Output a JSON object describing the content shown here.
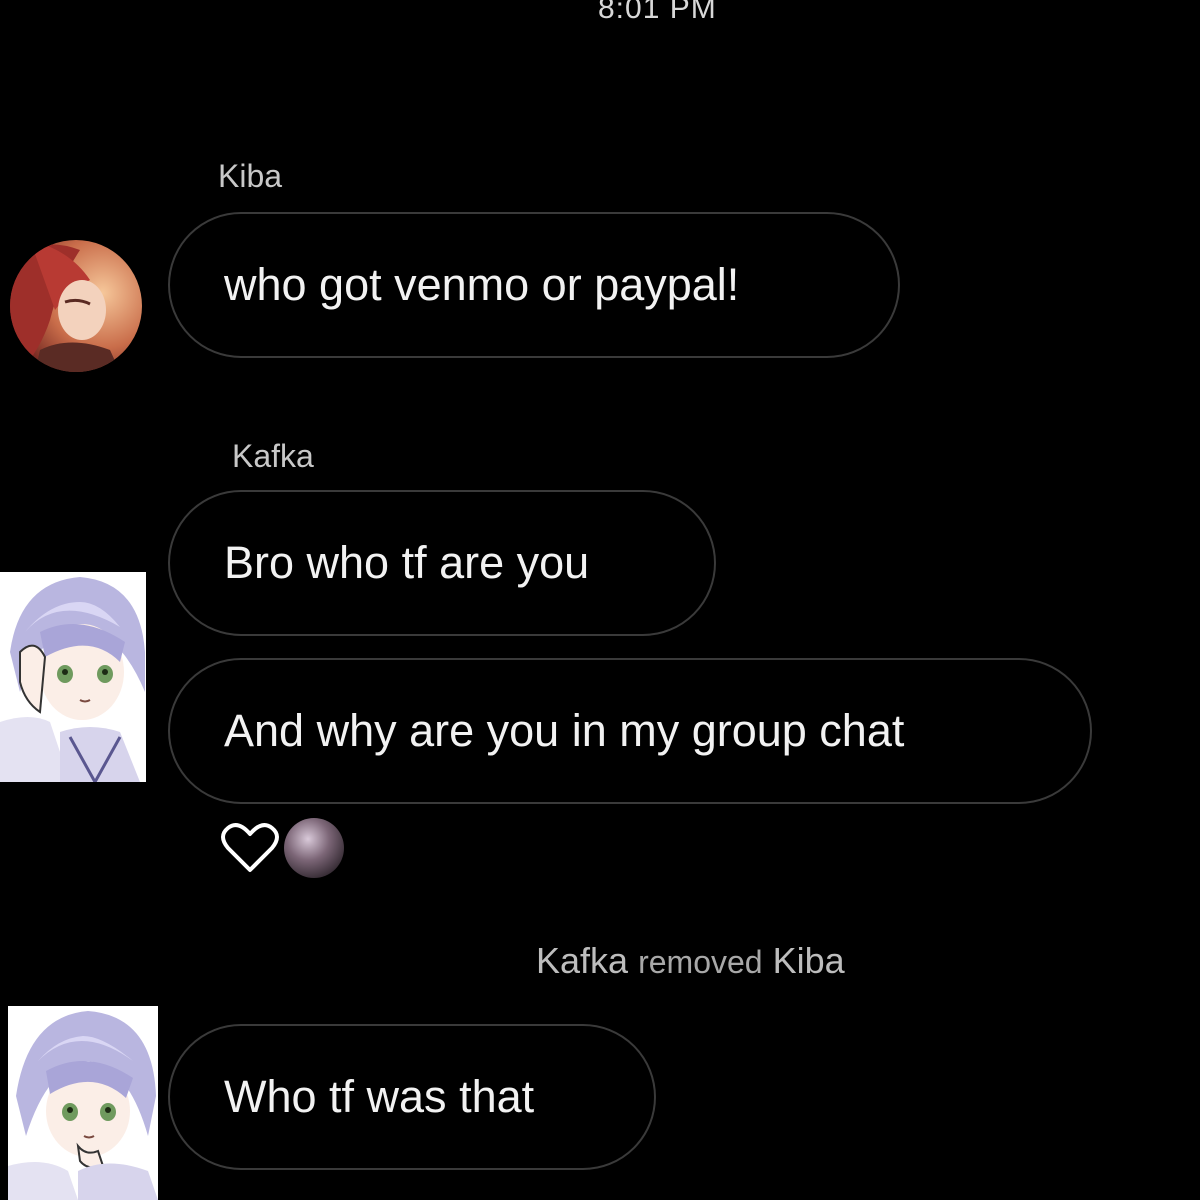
{
  "header": {
    "timestamp": "8:01 PM"
  },
  "messages": [
    {
      "sender": "Kiba",
      "text": "who got venmo or paypal!",
      "avatar_icon": "red-haired-character-avatar"
    },
    {
      "sender": "Kafka",
      "lines": [
        "Bro who tf are you",
        "And why are you in my group chat"
      ],
      "avatar_icon": "lavender-haired-character-avatar"
    }
  ],
  "reaction": {
    "icon": "heart-outline-icon",
    "reactor_avatar": "reactor-avatar"
  },
  "system_event": {
    "actor": "Kafka",
    "verb": "removed",
    "target": "Kiba"
  },
  "final_message": {
    "text": "Who tf was that",
    "avatar_icon": "lavender-haired-character-avatar"
  },
  "colors": {
    "background": "#000000",
    "bubble_border": "#3a3a3a",
    "text": "#f2f2f2",
    "name_text": "#c8c8c8"
  }
}
